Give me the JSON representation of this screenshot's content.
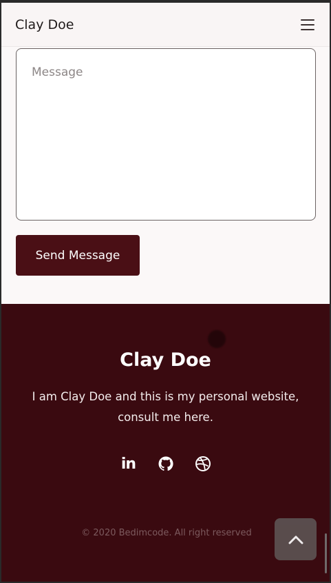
{
  "header": {
    "brand": "Clay Doe",
    "menu_icon": "hamburger-menu-icon"
  },
  "form": {
    "message_placeholder": "Message",
    "message_value": "",
    "send_label": "Send Message"
  },
  "footer": {
    "title": "Clay Doe",
    "description": "I am Clay Doe and this is my personal website, consult me here.",
    "socials": [
      {
        "icon": "linkedin-icon",
        "glyph": "in"
      },
      {
        "icon": "github-icon"
      },
      {
        "icon": "dribbble-icon"
      }
    ],
    "copyright": "© 2020 Bedimcode. All right reserved",
    "scroll_top_icon": "chevron-up-icon"
  },
  "colors": {
    "primary": "#4a0f15",
    "footer_bg": "#3a0a10",
    "page_bg": "#fbf8f8"
  }
}
